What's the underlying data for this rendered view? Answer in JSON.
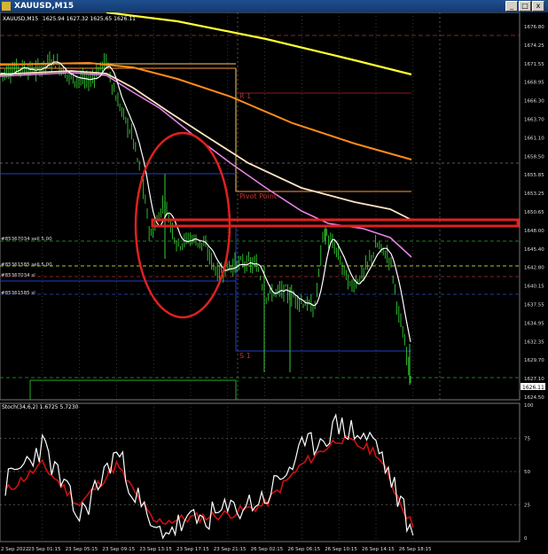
{
  "window": {
    "title": "XAUUSD,M15",
    "minimize": "_",
    "maximize": "□",
    "close": "x"
  },
  "main_header": {
    "symbol": "XAUUSD,M15",
    "ohlc": "1625.94 1627.32 1625.65 1626.11"
  },
  "sub_header": "Stoch(34,6,2) 1.6725 5.7230",
  "price_axis": [
    "1676.80",
    "1674.25",
    "1671.55",
    "1668.95",
    "1666.30",
    "1663.70",
    "1661.10",
    "1658.50",
    "1655.85",
    "1653.25",
    "1650.65",
    "1648.00",
    "1645.40",
    "1642.80",
    "1640.15",
    "1637.55",
    "1634.95",
    "1632.35",
    "1629.70",
    "1627.10",
    "1624.50"
  ],
  "current_price": "1626.11",
  "stoch_axis": [
    "100",
    "75",
    "50",
    "25",
    "0"
  ],
  "time_axis": [
    "2 Sep 2022",
    "23 Sep 01:15",
    "23 Sep 05:15",
    "23 Sep 09:15",
    "23 Sep 13:15",
    "23 Sep 17:15",
    "23 Sep 21:15",
    "26 Sep 02:15",
    "26 Sep 06:15",
    "26 Sep 10:15",
    "26 Sep 14:15",
    "26 Sep 18:15"
  ],
  "level_labels": {
    "r1": "R 1",
    "pivot": "Pivot Point",
    "s1": "S 1"
  },
  "order_labels": [
    "#85367034 sell 5.00",
    "#85361585 sell 5.00",
    "#85367034 sl",
    "#85361585 sl"
  ],
  "colors": {
    "candles": "#33cc33",
    "ma_yellow": "#ffff33",
    "ma_orange": "#ff8c1a",
    "ma_cream": "#ffe4c4",
    "ma_violet": "#e680e6",
    "price_line": "#ffffff",
    "stoch_main": "#ffffff",
    "stoch_signal": "#cc1111",
    "annotation_red": "#e02020",
    "pivot_line": "#ff9933",
    "r1_line": "#8b1a1a",
    "s1_line": "#1f3fbf"
  },
  "chart_data": [
    {
      "type": "line",
      "title": "XAUUSD,M15",
      "x": [
        "2 Sep 2022",
        "23 Sep 01:15",
        "23 Sep 05:15",
        "23 Sep 09:15",
        "23 Sep 13:15",
        "23 Sep 17:15",
        "23 Sep 21:15",
        "26 Sep 02:15",
        "26 Sep 06:15",
        "26 Sep 10:15",
        "26 Sep 14:15",
        "26 Sep 18:15"
      ],
      "series": [
        {
          "values": [
            1670.5,
            1671.5,
            1670.0,
            1668.0,
            1645.0,
            1646.0,
            1642.5,
            1638.5,
            1637.0,
            1647.0,
            1645.0,
            1626.11
          ]
        }
      ],
      "ylim": [
        1624.5,
        1678.0
      ],
      "grid": true
    },
    {
      "type": "line",
      "title": "Stoch(34,6,2) 1.6725 5.7230",
      "x": [
        "2 Sep 2022",
        "23 Sep 01:15",
        "23 Sep 05:15",
        "23 Sep 09:15",
        "23 Sep 13:15",
        "23 Sep 17:15",
        "23 Sep 21:15",
        "26 Sep 02:15",
        "26 Sep 06:15",
        "26 Sep 10:15",
        "26 Sep 14:15",
        "26 Sep 18:15"
      ],
      "series": [
        {
          "values": [
            40,
            70,
            15,
            65,
            3,
            12,
            20,
            30,
            65,
            85,
            72,
            2
          ]
        },
        {
          "values": [
            35,
            55,
            25,
            55,
            12,
            15,
            18,
            25,
            55,
            75,
            65,
            8
          ]
        }
      ],
      "ylim": [
        0,
        100
      ],
      "grid": true
    }
  ]
}
